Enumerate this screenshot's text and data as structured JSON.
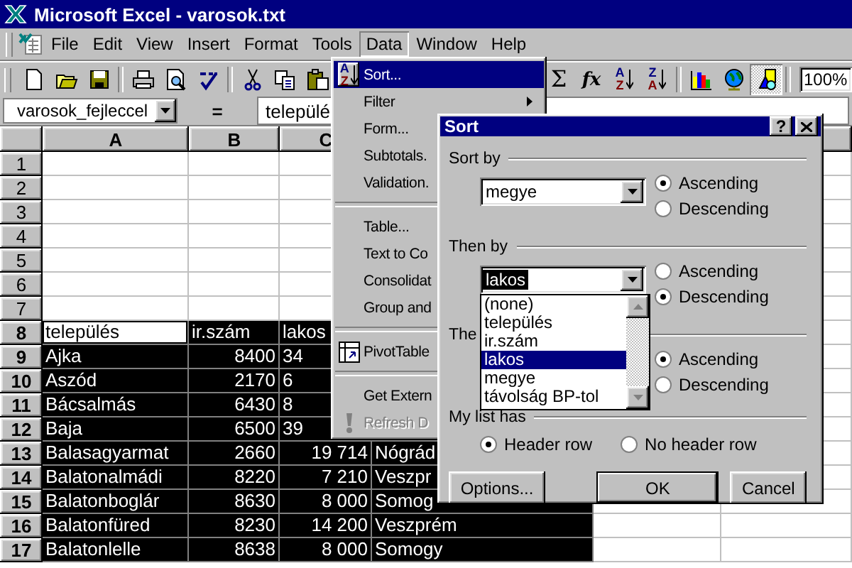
{
  "window": {
    "title": "Microsoft Excel - varosok.txt"
  },
  "menu_bar": [
    {
      "label": "File",
      "selected": false
    },
    {
      "label": "Edit",
      "selected": false
    },
    {
      "label": "View",
      "selected": false
    },
    {
      "label": "Insert",
      "selected": false
    },
    {
      "label": "Format",
      "selected": false
    },
    {
      "label": "Tools",
      "selected": false
    },
    {
      "label": "Data",
      "selected": true
    },
    {
      "label": "Window",
      "selected": false
    },
    {
      "label": "Help",
      "selected": false
    }
  ],
  "toolbar": {
    "autosum": "Σ",
    "function": "fx",
    "sort_ascending": {
      "top": "A",
      "bottom": "Z"
    },
    "sort_descending": {
      "top": "Z",
      "bottom": "A"
    },
    "zoom": "100%"
  },
  "formula_bar": {
    "name_box": "varosok_fejleccel",
    "equals": "=",
    "content": "települé"
  },
  "sheet": {
    "columns": [
      "A",
      "B",
      "C"
    ],
    "rows": [
      {
        "header": "1",
        "kind": "blank",
        "selected": false,
        "active": false
      },
      {
        "header": "2",
        "kind": "blank",
        "selected": false,
        "active": false
      },
      {
        "header": "3",
        "kind": "blank",
        "selected": false,
        "active": false
      },
      {
        "header": "4",
        "kind": "blank",
        "selected": false,
        "active": false
      },
      {
        "header": "5",
        "kind": "blank",
        "selected": false,
        "active": false
      },
      {
        "header": "6",
        "kind": "blank",
        "selected": false,
        "active": false
      },
      {
        "header": "7",
        "kind": "blank",
        "selected": false,
        "active": false
      },
      {
        "header": "8",
        "kind": "header",
        "selected": true,
        "active": true,
        "cells": [
          "település",
          "ir.szám",
          "lakos"
        ]
      },
      {
        "header": "9",
        "kind": "covered",
        "selected": true,
        "active": false,
        "cells": [
          "Ajka",
          "8400",
          "34"
        ]
      },
      {
        "header": "10",
        "kind": "covered",
        "selected": true,
        "active": false,
        "cells": [
          "Aszód",
          "2170",
          "6"
        ]
      },
      {
        "header": "11",
        "kind": "covered",
        "selected": true,
        "active": false,
        "cells": [
          "Bácsalmás",
          "6430",
          "8"
        ]
      },
      {
        "header": "12",
        "kind": "covered",
        "selected": true,
        "active": false,
        "cells": [
          "Baja",
          "6500",
          "39"
        ]
      },
      {
        "header": "13",
        "kind": "record",
        "selected": true,
        "active": false,
        "cells": [
          "Balasagyarmat",
          "2660",
          "19 714",
          "Nógrád"
        ]
      },
      {
        "header": "14",
        "kind": "record",
        "selected": true,
        "active": false,
        "cells": [
          "Balatonalmádi",
          "8220",
          "7 210",
          "Veszpr"
        ]
      },
      {
        "header": "15",
        "kind": "record",
        "selected": true,
        "active": false,
        "cells": [
          "Balatonboglár",
          "8630",
          "8 000",
          "Somog"
        ]
      },
      {
        "header": "16",
        "kind": "record",
        "selected": true,
        "active": false,
        "cells": [
          "Balatonfüred",
          "8230",
          "14 200",
          "Veszprém"
        ]
      },
      {
        "header": "17",
        "kind": "record",
        "selected": true,
        "active": false,
        "cells": [
          "Balatonlelle",
          "8638",
          "8 000",
          "Somogy"
        ]
      }
    ]
  },
  "data_menu": [
    {
      "kind": "item",
      "label": "Sort...",
      "selected": true,
      "disabled": false,
      "submenu": false,
      "icon_letters": {
        "top": "A",
        "bottom": "Z"
      }
    },
    {
      "kind": "item",
      "label": "Filter",
      "selected": false,
      "disabled": false,
      "submenu": true
    },
    {
      "kind": "item",
      "label": "Form...",
      "selected": false,
      "disabled": false,
      "submenu": false
    },
    {
      "kind": "item",
      "label": "Subtotals.",
      "selected": false,
      "disabled": false,
      "submenu": false
    },
    {
      "kind": "item",
      "label": "Validation.",
      "selected": false,
      "disabled": false,
      "submenu": false
    },
    {
      "kind": "separator"
    },
    {
      "kind": "item",
      "label": "Table...",
      "selected": false,
      "disabled": false,
      "submenu": false
    },
    {
      "kind": "item",
      "label": "Text to Co",
      "selected": false,
      "disabled": false,
      "submenu": false
    },
    {
      "kind": "item",
      "label": "Consolidat",
      "selected": false,
      "disabled": false,
      "submenu": false
    },
    {
      "kind": "item",
      "label": "Group and",
      "selected": false,
      "disabled": false,
      "submenu": false
    },
    {
      "kind": "separator"
    },
    {
      "kind": "item",
      "label": "PivotTable",
      "selected": false,
      "disabled": false,
      "submenu": false
    },
    {
      "kind": "separator"
    },
    {
      "kind": "item",
      "label": "Get Extern",
      "selected": false,
      "disabled": false,
      "submenu": false
    },
    {
      "kind": "item",
      "label": "Refresh D",
      "selected": false,
      "disabled": true,
      "submenu": false
    }
  ],
  "sort_dialog": {
    "title": "Sort",
    "help": "?",
    "groups": [
      {
        "label": "Sort by",
        "value": "megye",
        "expanded": false,
        "options": [
          {
            "label": "Ascending",
            "selected": true
          },
          {
            "label": "Descending",
            "selected": false
          }
        ]
      },
      {
        "label": "Then by",
        "value": "lakos",
        "expanded": true,
        "options": [
          {
            "label": "Ascending",
            "selected": false
          },
          {
            "label": "Descending",
            "selected": true
          }
        ]
      },
      {
        "label": "The",
        "options": [
          {
            "label": "Ascending",
            "selected": true
          },
          {
            "label": "Descending",
            "selected": false
          }
        ]
      }
    ],
    "dropdown_list": [
      {
        "label": "(none)",
        "selected": false
      },
      {
        "label": "település",
        "selected": false
      },
      {
        "label": "ir.szám",
        "selected": false
      },
      {
        "label": "lakos",
        "selected": true
      },
      {
        "label": "megye",
        "selected": false
      },
      {
        "label": "távolság BP-tol",
        "selected": false
      }
    ],
    "list_has": {
      "label": "My list has",
      "options": [
        {
          "label": "Header row",
          "selected": true
        },
        {
          "label": "No header row",
          "selected": false
        }
      ]
    },
    "buttons": [
      {
        "label": "Options...",
        "default": false
      },
      {
        "label": "OK",
        "default": true
      },
      {
        "label": "Cancel",
        "default": false
      }
    ]
  }
}
